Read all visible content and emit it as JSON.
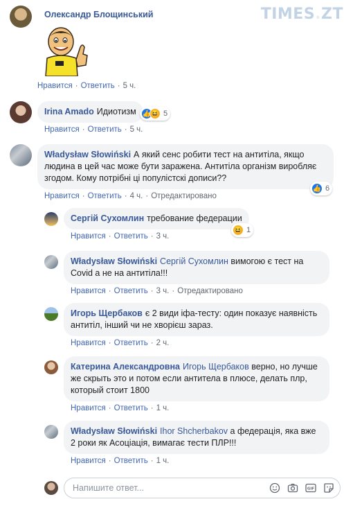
{
  "watermark": {
    "brand": "TIMES",
    "dot": ".",
    "suffix": "ZT"
  },
  "actions": {
    "like": "Нравится",
    "reply": "Ответить",
    "sep": "·",
    "edited": "Отредактировано"
  },
  "comments": [
    {
      "author": "Олександр Блощинський",
      "text": "",
      "sticker": "referee-thumbs-up-sticker",
      "time": "5 ч."
    },
    {
      "author": "Irina Amado",
      "text": "Идиотизм",
      "reactions": [
        "like",
        "haha"
      ],
      "reaction_count": "5",
      "time": "5 ч."
    },
    {
      "author": "Władysław Słowiński",
      "text_line1": "А який сенс робити тест на антитіла, якщо",
      "text_line2": "людина в цей час може бути заражена. Антитіла організм виробляє",
      "text_line3": "згодом. Кому потрібні ці популістскі дописи??",
      "reactions": [
        "like"
      ],
      "reaction_count": "6",
      "time": "4 ч.",
      "edited": true
    }
  ],
  "replies": [
    {
      "author": "Сергій Сухомлин",
      "text": "требование федерации",
      "reactions": [
        "haha"
      ],
      "reaction_count": "1",
      "time": "3 ч."
    },
    {
      "author": "Władysław Słowiński",
      "mention": "Сергій Сухомлин",
      "text_line1": "вимогою є тест на",
      "text_line2": "Covid а не на антитіла!!!",
      "time": "3 ч.",
      "edited": true
    },
    {
      "author": "Игорь Щербаков",
      "text_line1": "є 2 види іфа-тесту: один показує наявність",
      "text_line2": "антитіл, інший чи не хворієш зараз.",
      "time": "2 ч."
    },
    {
      "author": "Катерина Александровна",
      "mention": "Игорь Щербаков",
      "text_line1": "верно, но лучше",
      "text_line2": "же скрыть это и потом если антитела в плюсе, делать плр,",
      "text_line3": "который стоит 1800",
      "time": "1 ч."
    },
    {
      "author": "Władysław Słowiński",
      "mention": "Ihor Shcherbakov",
      "text_line1": "а федерація, яка вже",
      "text_line2": "2 роки як Асоціація, вимагає тести ПЛР!!!",
      "time": "1 ч."
    }
  ],
  "reply_box": {
    "placeholder": "Напишите ответ..."
  },
  "icons": [
    "emoji-icon",
    "camera-icon",
    "gif-icon",
    "sticker-icon"
  ],
  "colors": {
    "link": "#385898",
    "action": "#4267b2",
    "bubble": "#f2f3f5",
    "like": "#1877f2",
    "haha": "#f7b125"
  }
}
